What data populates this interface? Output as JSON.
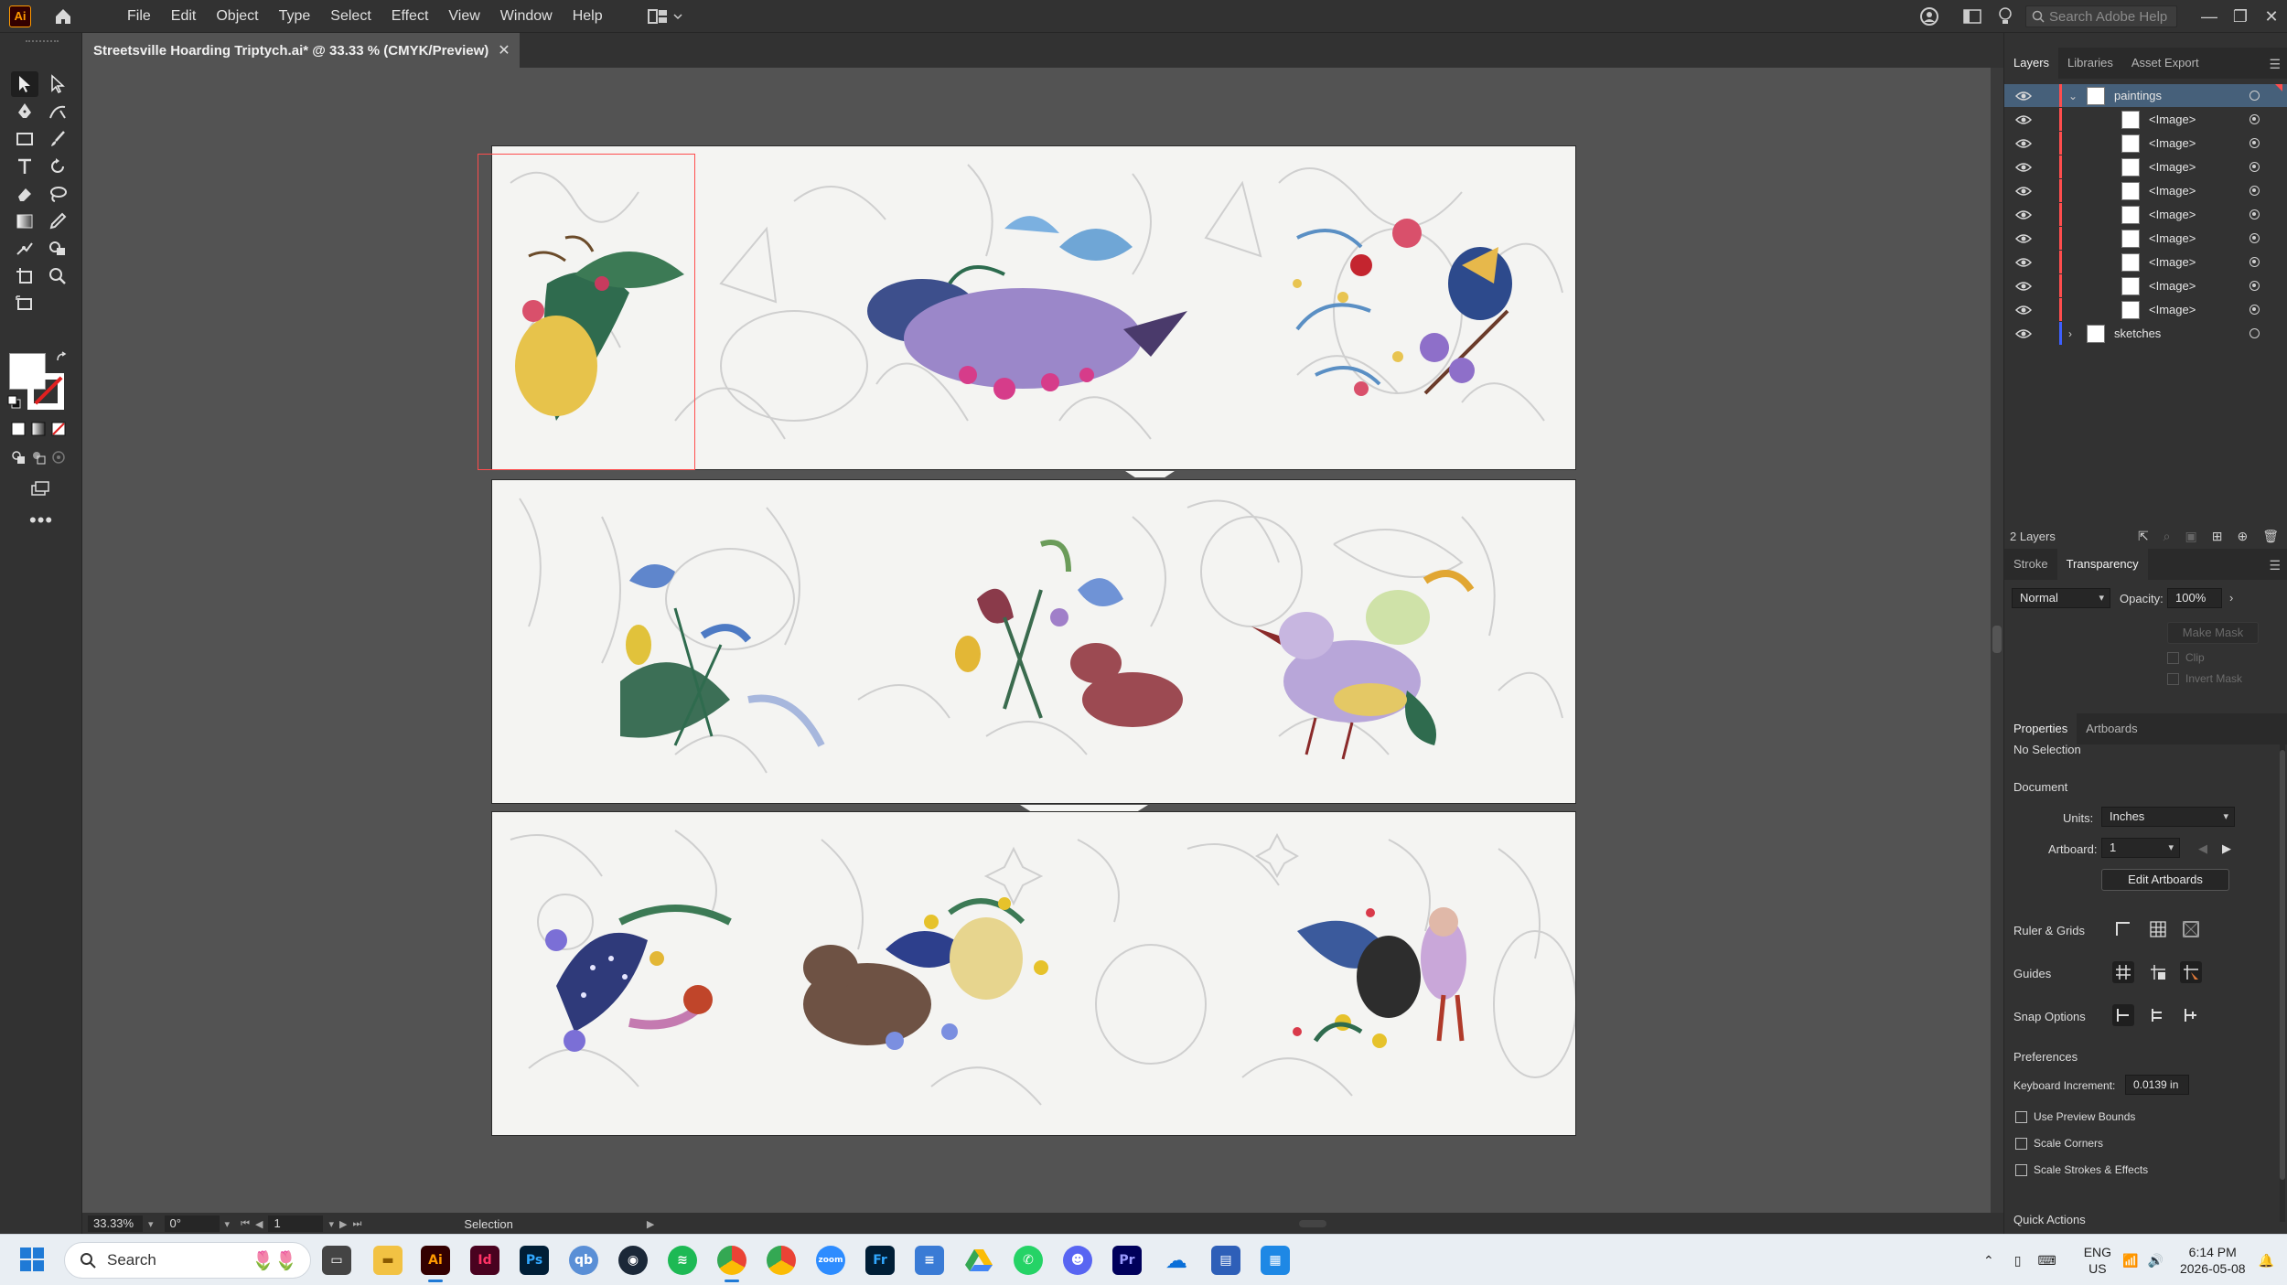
{
  "app": {
    "logo": "Ai",
    "menus": [
      "File",
      "Edit",
      "Object",
      "Type",
      "Select",
      "Effect",
      "View",
      "Window",
      "Help"
    ],
    "search_placeholder": "Search Adobe Help"
  },
  "document": {
    "tab_title": "Streetsville Hoarding Triptych.ai* @ 33.33 % (CMYK/Preview)",
    "close_glyph": "✕"
  },
  "status": {
    "zoom": "33.33%",
    "rotation": "0°",
    "artboard": "1",
    "tool": "Selection"
  },
  "layers_panel": {
    "tabs": [
      "Layers",
      "Libraries",
      "Asset Export"
    ],
    "layers": [
      {
        "name": "paintings",
        "expanded": true,
        "color": "#ff4d4d",
        "selected": true
      },
      {
        "name": "<Image>",
        "child": true
      },
      {
        "name": "<Image>",
        "child": true
      },
      {
        "name": "<Image>",
        "child": true
      },
      {
        "name": "<Image>",
        "child": true
      },
      {
        "name": "<Image>",
        "child": true
      },
      {
        "name": "<Image>",
        "child": true
      },
      {
        "name": "<Image>",
        "child": true
      },
      {
        "name": "<Image>",
        "child": true
      },
      {
        "name": "<Image>",
        "child": true
      },
      {
        "name": "sketches",
        "expanded": false,
        "color": "#3d5fff"
      }
    ],
    "footer_count": "2 Layers"
  },
  "transparency_panel": {
    "tabs": [
      "Stroke",
      "Transparency"
    ],
    "blend_mode": "Normal",
    "opacity_label": "Opacity:",
    "opacity_value": "100%",
    "make_mask": "Make Mask",
    "clip": "Clip",
    "invert_mask": "Invert Mask"
  },
  "properties_panel": {
    "tabs": [
      "Properties",
      "Artboards"
    ],
    "selection_state": "No Selection",
    "document_heading": "Document",
    "units_label": "Units:",
    "units_value": "Inches",
    "artboard_label": "Artboard:",
    "artboard_value": "1",
    "edit_artboards": "Edit Artboards",
    "ruler_grids": "Ruler & Grids",
    "guides": "Guides",
    "snap_options": "Snap Options",
    "preferences": "Preferences",
    "keyboard_increment_label": "Keyboard Increment:",
    "keyboard_increment_value": "0.0139 in",
    "use_preview_bounds": "Use Preview Bounds",
    "scale_corners": "Scale Corners",
    "scale_strokes_effects": "Scale Strokes & Effects",
    "quick_actions": "Quick Actions"
  },
  "taskbar": {
    "search_label": "Search",
    "apps": [
      "Ai",
      "Id",
      "Ps",
      "qb",
      "steam",
      "spotify",
      "chrome",
      "chrome",
      "zoom",
      "Fr",
      "notepad",
      "drive",
      "whatsapp",
      "discord",
      "Pr",
      "onedrive",
      "app",
      "app"
    ],
    "language_line1": "ENG",
    "language_line2": "US",
    "time": "6:14 PM",
    "date": "2026-05-08"
  },
  "colors": {
    "accent": "#46607a",
    "selection_red": "#ff4d4d",
    "sketch_blue": "#3d5fff",
    "panel_bg": "#323232",
    "canvas_bg": "#535353"
  },
  "artboards": {
    "count": 3,
    "content": [
      "painting-panel-top",
      "painting-panel-middle",
      "painting-panel-bottom"
    ]
  }
}
